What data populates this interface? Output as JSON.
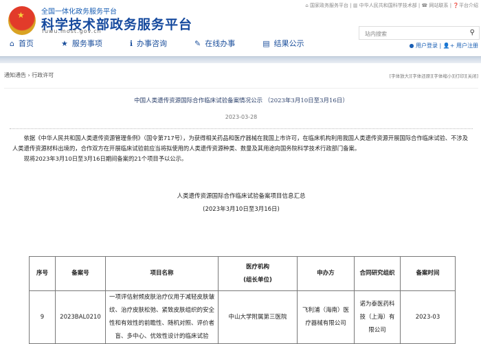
{
  "header": {
    "subtitle": "全国一体化政务服务平台",
    "title": "科学技术部政务服务平台",
    "url": "fuwu.most.gov.cn",
    "top_links": [
      "国家政务服务平台",
      "中华人民共和国科学技术部",
      "网站联系",
      "平台介绍"
    ],
    "search_placeholder": "站内搜索",
    "login": "用户登录",
    "register": "用户注册"
  },
  "nav": [
    {
      "icon": "home-icon",
      "label": "首页"
    },
    {
      "icon": "star-icon",
      "label": "服务事项"
    },
    {
      "icon": "info-icon",
      "label": "办事咨询"
    },
    {
      "icon": "pencil-icon",
      "label": "在线办事"
    },
    {
      "icon": "book-icon",
      "label": "结果公示"
    }
  ],
  "breadcrumb": [
    "通知通告",
    "行政许可"
  ],
  "tools": "[字体放大][字体还原][字体缩小][打印][关闭]",
  "article": {
    "title": "中国人类遗传资源国际合作临床试验备案情况公示 （2023年3月10日至3月16日）",
    "date": "2023-03-28",
    "para1": "依据《中华人民共和国人类遗传资源管理条例》（国令第717号），为获得相关药品和医疗器械在我国上市许可，在临床机构利用我国人类遗传资源开展国际合作临床试验、不涉及人类遗传资源材料出境的，合作双方在开展临床试验前应当将拟使用的人类遗传资源种类、数量及其用途向国务院科学技术行政部门备案。",
    "para2": "现将2023年3月10日至3月16日期间备案的21个项目予以公示。",
    "table_title": "人类遗传资源国际合作临床试验备案项目信息汇总",
    "table_period": "(2023年3月10日至3月16日)"
  },
  "table": {
    "headers": [
      "序号",
      "备案号",
      "项目名称",
      "医疗机构\n(组长单位)",
      "申办方",
      "合同研究组织",
      "备案时间"
    ],
    "rows": [
      [
        "9",
        "2023BAL0210",
        "一项评估射频皮肤治疗仪用于减轻皮肤皱纹、治疗皮肤松弛、紧致皮肤组织的安全性和有效性的前瞻性、随机对照、评价者盲、多中心、优效性设计的临床试验",
        "中山大学附属第三医院",
        "飞利浦（海南）医疗器械有限公司",
        "诺为泰医药科技（上海）有限公司",
        "2023-03"
      ]
    ]
  }
}
